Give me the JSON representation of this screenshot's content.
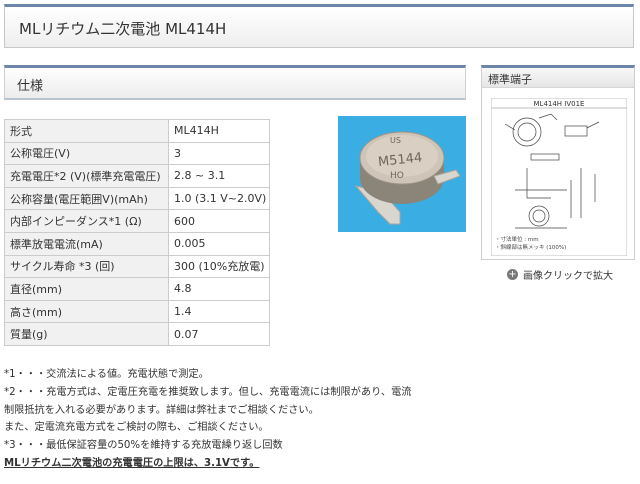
{
  "page": {
    "title": "MLリチウム二次電池 ML414H"
  },
  "spec": {
    "heading": "仕様",
    "rows": [
      {
        "label": "形式",
        "value": "ML414H"
      },
      {
        "label": "公称電圧(V)",
        "value": "3"
      },
      {
        "label": "充電電圧*2 (V)(標準充電電圧)",
        "value": "2.8 ~ 3.1"
      },
      {
        "label": "公称容量(電圧範囲V)(mAh)",
        "value": "1.0 (3.1 V~2.0V)"
      },
      {
        "label": "内部インピーダンス*1 (Ω)",
        "value": "600"
      },
      {
        "label": "標準放電電流(mA)",
        "value": "0.005"
      },
      {
        "label": "サイクル寿命 *3 (回)",
        "value": "300 (10%充放電)"
      },
      {
        "label": "直径(mm)",
        "value": "4.8"
      },
      {
        "label": "高さ(mm)",
        "value": "1.4"
      },
      {
        "label": "質量(g)",
        "value": "0.07"
      }
    ]
  },
  "photo": {
    "marking_line1": "US",
    "marking_line2": "M5144",
    "marking_line3": "HO"
  },
  "terminal": {
    "heading": "標準端子",
    "drawing_title": "ML414H IV01E",
    "note1": "・寸法単位 : mm",
    "note2": "・斜線部は無メッキ (100%)",
    "zoom_label": "画像クリックで拡大"
  },
  "notes": {
    "n1": "*1・・・交流法による値。充電状態で測定。",
    "n2a": "*2・・・充電方式は、定電圧充電を推奨致します。但し、充電電流には制限があり、電流",
    "n2b": "制限抵抗を入れる必要があります。詳細は弊社までご相談ください。",
    "n2c": "また、定電流充電方式をご検討の際も、ご相談ください。",
    "n3": "*3・・・最低保証容量の50%を維持する充放電繰り返し回数",
    "emphasis": "MLリチウム二次電池の充電電圧の上限は、3.1Vです。"
  },
  "colors": {
    "accent": "#6b86a8",
    "photo_bg": "#3aaee2"
  }
}
